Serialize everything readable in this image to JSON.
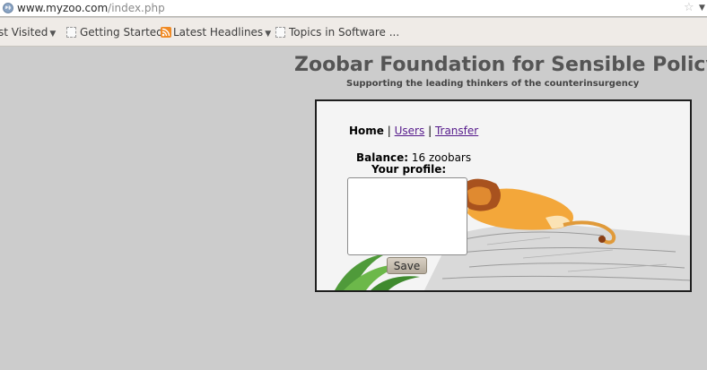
{
  "browser": {
    "url_domain": "www.myzoo.com",
    "url_path": "/index.php",
    "bookmarks": [
      {
        "label": "st Visited",
        "dropdown": true
      },
      {
        "label": "Getting Started",
        "dropdown": false
      },
      {
        "label": "Latest Headlines",
        "dropdown": true
      },
      {
        "label": "Topics in Software ...",
        "dropdown": false
      }
    ]
  },
  "page": {
    "title": "Zoobar Foundation for Sensible Policy",
    "subtitle": "Supporting the leading thinkers of the counterinsurgency"
  },
  "nav": {
    "home": "Home",
    "users": "Users",
    "transfer": "Transfer",
    "separator": "|"
  },
  "account": {
    "balance_label": "Balance:",
    "balance_value": "16 zoobars",
    "profile_label": "Your profile:",
    "profile_text": ""
  },
  "actions": {
    "save_label": "Save"
  },
  "icons": {
    "globe": "globe-icon",
    "star": "bookmark-star-icon",
    "page": "page-icon",
    "rss": "rss-feed-icon",
    "dropdown": "dropdown-arrow-icon"
  },
  "colors": {
    "page_bg": "#cccccc",
    "title": "#555555",
    "link": "#551a8b",
    "rss": "#f08a24"
  }
}
